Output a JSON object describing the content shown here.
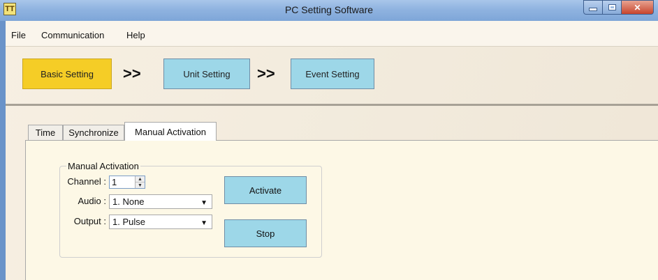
{
  "window": {
    "title": "PC Setting Software",
    "icon_text": "TT"
  },
  "menu": [
    "File",
    "Communication",
    "Help"
  ],
  "steps": {
    "basic_label": "Basic Setting",
    "unit_label": "Unit Setting",
    "event_label": "Event Setting",
    "separator": ">>",
    "active_step": "Basic Setting"
  },
  "tabs": {
    "items": [
      "Time",
      "Synchronize",
      "Manual Activation"
    ],
    "active": "Manual Activation"
  },
  "manual_activation": {
    "group_title": "Manual Activation",
    "channel_label": "Channel :",
    "channel_value": "1",
    "audio_label": "Audio :",
    "audio_value": "1. None",
    "output_label": "Output :",
    "output_value": "1. Pulse",
    "activate_label": "Activate",
    "stop_label": "Stop"
  },
  "colors": {
    "active_step": "#f5cd26",
    "step_button": "#9dd7e8",
    "panel_bg": "#fdf8e6",
    "title_bar": "#8fb3e0"
  },
  "icons": [
    "app-icon",
    "minimize-icon",
    "maximize-icon",
    "close-icon",
    "spin-up-icon",
    "spin-down-icon",
    "dropdown-arrow-icon"
  ]
}
